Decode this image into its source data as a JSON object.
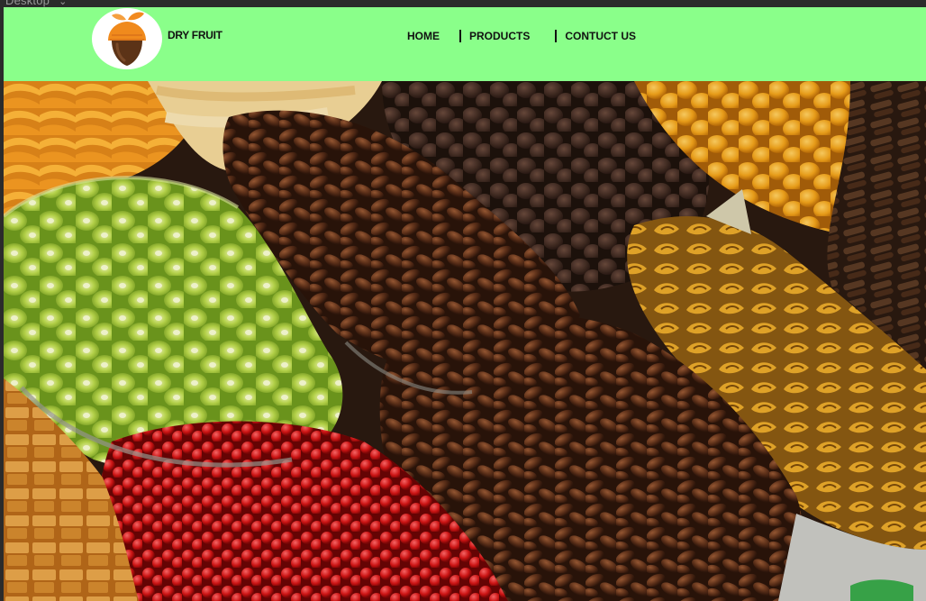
{
  "window": {
    "frame_label": "Desktop",
    "frame_chevron": "⌄"
  },
  "header": {
    "background": "#8aff8a",
    "brand": "DRY FRUIT",
    "logo_icon": "acorn-icon",
    "nav": [
      {
        "label": "HOME"
      },
      {
        "label": "PRODUCTS"
      },
      {
        "label": "CONTUCT US"
      }
    ]
  },
  "hero": {
    "image": "dried-fruits-photo"
  }
}
